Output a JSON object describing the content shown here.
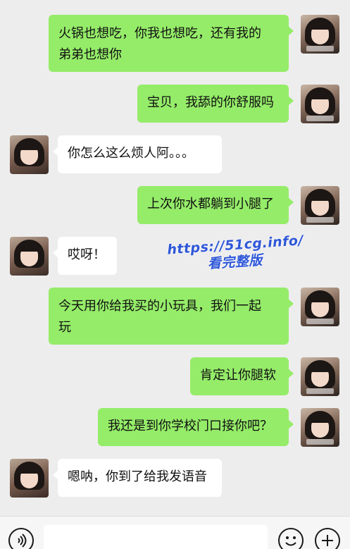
{
  "messages": [
    {
      "sender": "me",
      "lines": [
        "火锅也想吃，你我也想吃，还有我的",
        "弟弟也想你"
      ]
    },
    {
      "sender": "me",
      "lines": [
        "宝贝，我舔的你舒服吗"
      ]
    },
    {
      "sender": "her",
      "lines": [
        "你怎么这么烦人阿。。。"
      ]
    },
    {
      "sender": "me",
      "lines": [
        "上次你水都躺到小腿了"
      ]
    },
    {
      "sender": "her",
      "lines": [
        "哎呀！"
      ]
    },
    {
      "sender": "me",
      "lines": [
        "今天用你给我买的小玩具，我们一起",
        "玩"
      ]
    },
    {
      "sender": "me",
      "lines": [
        "肯定让你腿软"
      ]
    },
    {
      "sender": "me",
      "lines": [
        "我还是到你学校门口接你吧？"
      ]
    },
    {
      "sender": "her",
      "lines": [
        "嗯呐，你到了给我发语音"
      ]
    }
  ],
  "watermark": {
    "line1": "https://51cg.info/",
    "line2": "看完整版"
  },
  "input_bar": {
    "voice_icon": "voice-wave-icon",
    "emoji_icon": "smiley-face-icon",
    "plus_icon": "plus-icon",
    "input_value": ""
  },
  "colors": {
    "background": "#ededed",
    "my_bubble": "#95ec69",
    "her_bubble": "#ffffff",
    "watermark": "#2f57d8"
  }
}
